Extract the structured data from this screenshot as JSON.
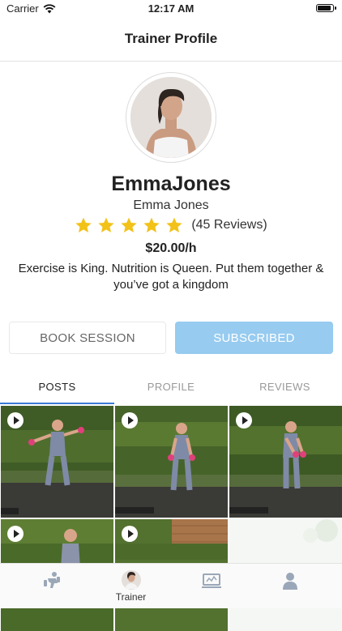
{
  "status_bar": {
    "carrier": "Carrier",
    "time": "12:17 AM"
  },
  "header": {
    "title": "Trainer Profile"
  },
  "profile": {
    "username": "EmmaJones",
    "full_name": "Emma Jones",
    "rating_stars": 5,
    "reviews_label": "(45 Reviews)",
    "price": "$20.00/h",
    "bio": "Exercise is King. Nutrition is Queen. Put them together & you’ve got a kingdom"
  },
  "actions": {
    "book_label": "BOOK SESSION",
    "subscribe_label": "SUBSCRIBED"
  },
  "tabs": [
    {
      "label": "POSTS",
      "active": true
    },
    {
      "label": "PROFILE",
      "active": false
    },
    {
      "label": "REVIEWS",
      "active": false
    }
  ],
  "posts": [
    {
      "type": "video",
      "icon": "play-icon"
    },
    {
      "type": "video",
      "icon": "play-icon"
    },
    {
      "type": "video",
      "icon": "play-icon"
    },
    {
      "type": "video",
      "icon": "play-icon"
    },
    {
      "type": "video",
      "icon": "play-icon"
    },
    {
      "type": "image"
    }
  ],
  "tab_bar": [
    {
      "icon": "workout-icon",
      "label": ""
    },
    {
      "icon": "trainer-avatar-icon",
      "label": "Trainer",
      "active": true
    },
    {
      "icon": "laptop-icon",
      "label": ""
    },
    {
      "icon": "user-icon",
      "label": ""
    }
  ],
  "colors": {
    "accent_blue": "#97cbf0",
    "star_yellow": "#f2c219",
    "tab_indicator": "#3a7bd5",
    "icon_gray": "#9aa7b8"
  }
}
